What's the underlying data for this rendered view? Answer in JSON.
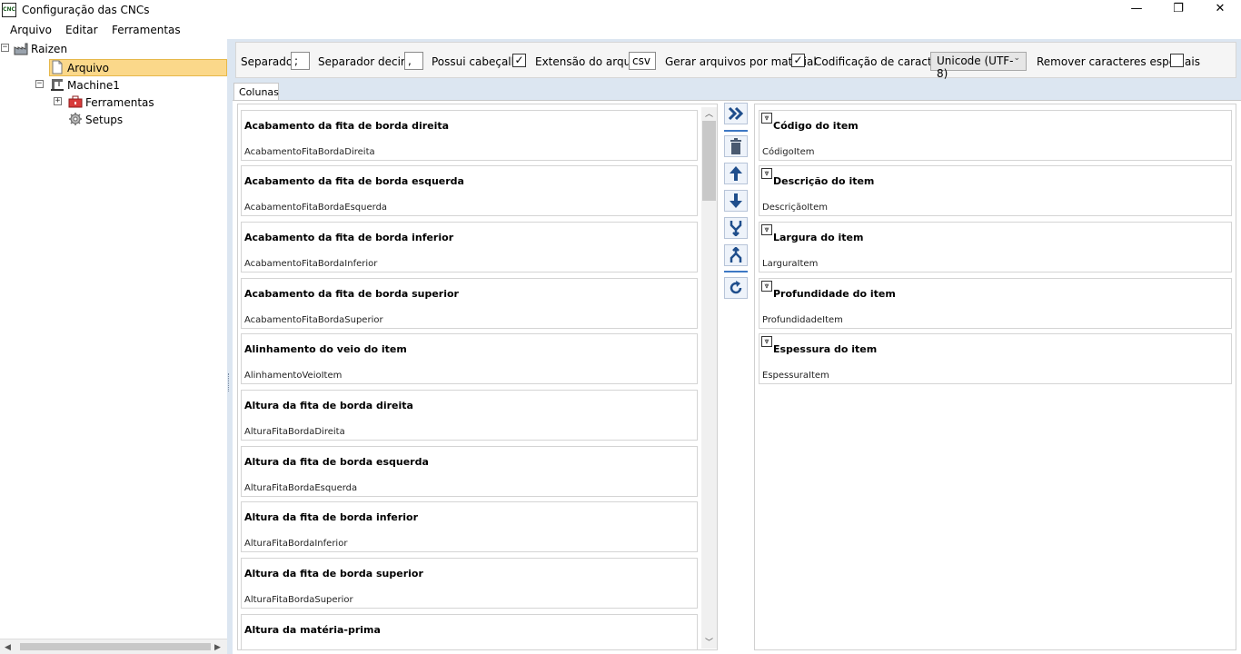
{
  "window": {
    "title": "Configuração das CNCs",
    "icon_text": "CNC",
    "minimize": "—",
    "restore": "❐",
    "close": "✕"
  },
  "menu": [
    "Arquivo",
    "Editar",
    "Ferramentas"
  ],
  "tree": {
    "root": "Raizen",
    "arquivo": "Arquivo",
    "machine": "Machine1",
    "ferramentas": "Ferramentas",
    "setups": "Setups",
    "expanded_symbol": "−",
    "collapsed_symbol": "+"
  },
  "toolbar": {
    "separador_label": "Separador",
    "separador_value": ";",
    "separador_decimal_label": "Separador decimal",
    "separador_decimal_value": ",",
    "possui_cabecalho_label": "Possui cabeçalho",
    "possui_cabecalho_checked": "✓",
    "extensao_label": "Extensão do arquivo",
    "extensao_value": "csv",
    "gerar_arquivos_label": "Gerar arquivos por material",
    "gerar_arquivos_checked": "✓",
    "codificacao_label": "Codificação de caracteres",
    "codificacao_value": "Unicode (UTF-8)",
    "remover_label": "Remover caracteres especiais",
    "remover_checked": ""
  },
  "tab_label": "Colunas",
  "available_columns": [
    {
      "title": "Acabamento da fita de borda direita",
      "field": "AcabamentoFitaBordaDireita"
    },
    {
      "title": "Acabamento da fita de borda esquerda",
      "field": "AcabamentoFitaBordaEsquerda"
    },
    {
      "title": "Acabamento da fita de borda inferior",
      "field": "AcabamentoFitaBordaInferior"
    },
    {
      "title": "Acabamento da fita de borda superior",
      "field": "AcabamentoFitaBordaSuperior"
    },
    {
      "title": "Alinhamento do veio do item",
      "field": "AlinhamentoVeioItem"
    },
    {
      "title": "Altura da fita de borda direita",
      "field": "AlturaFitaBordaDireita"
    },
    {
      "title": "Altura da fita de borda esquerda",
      "field": "AlturaFitaBordaEsquerda"
    },
    {
      "title": "Altura da fita de borda inferior",
      "field": "AlturaFitaBordaInferior"
    },
    {
      "title": "Altura da fita de borda superior",
      "field": "AlturaFitaBordaSuperior"
    },
    {
      "title": "Altura da matéria-prima",
      "field": ""
    }
  ],
  "selected_columns": [
    {
      "title": "Código do item",
      "field": "CódigoItem"
    },
    {
      "title": "Descrição do item",
      "field": "DescriçãoItem"
    },
    {
      "title": "Largura do item",
      "field": "LarguraItem"
    },
    {
      "title": "Profundidade do item",
      "field": "ProfundidadeItem"
    },
    {
      "title": "Espessura do item",
      "field": "EspessuraItem"
    }
  ],
  "colors": {
    "accent": "#3d78c4",
    "selection": "#fbd88a",
    "panel_bg": "#dce6f1"
  }
}
